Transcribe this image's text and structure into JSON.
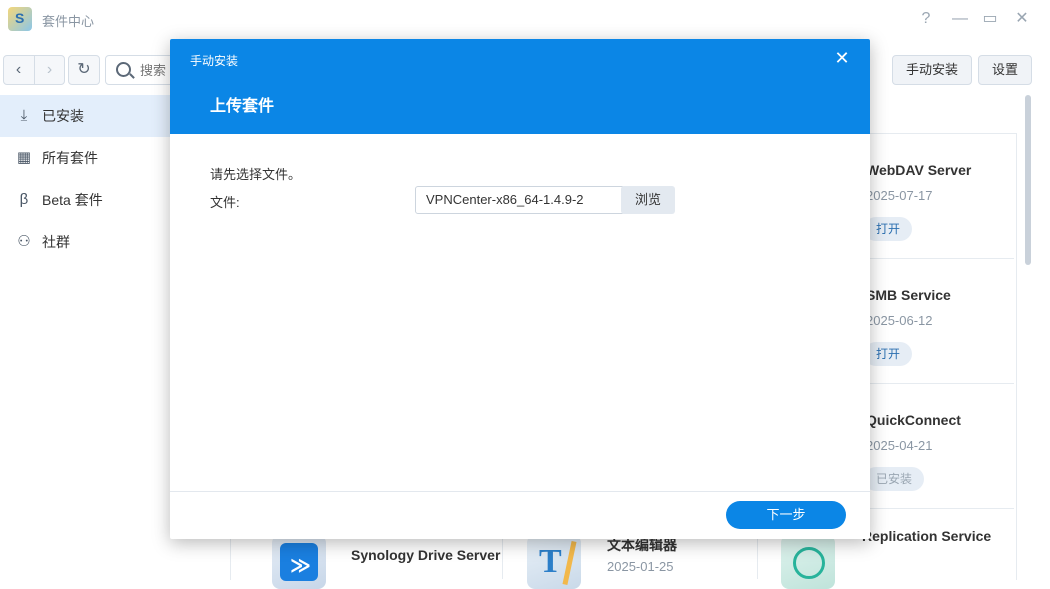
{
  "app": {
    "title": "套件中心"
  },
  "window_controls": {
    "help": "?",
    "minimize": "—",
    "maximize": "▭",
    "close": "✕"
  },
  "toolbar": {
    "back": "‹",
    "forward": "›",
    "refresh": "↻",
    "search_placeholder": "搜索",
    "manual_install_label": "手动安装",
    "settings_label": "设置"
  },
  "sidebar": {
    "items": [
      {
        "label": "已安装",
        "icon": "download-icon",
        "glyph": "⤓",
        "active": true
      },
      {
        "label": "所有套件",
        "icon": "grid-icon",
        "glyph": "▦",
        "active": false
      },
      {
        "label": "Beta 套件",
        "icon": "beta-icon",
        "glyph": "β",
        "active": false
      },
      {
        "label": "社群",
        "icon": "community-icon",
        "glyph": "⚇",
        "active": false
      }
    ]
  },
  "packages_right": [
    {
      "name": "WebDAV Server",
      "date": "2025-07-17",
      "action": "打开"
    },
    {
      "name": "SMB Service",
      "date": "2025-06-12",
      "action": "打开"
    },
    {
      "name": "QuickConnect",
      "date": "2025-04-21",
      "action": "已安装"
    },
    {
      "name": "Replication Service",
      "date": "",
      "action": ""
    }
  ],
  "packages_bottom": [
    {
      "name": "Synology Drive Server",
      "date": ""
    },
    {
      "name": "文本编辑器",
      "date": "2025-01-25"
    },
    {
      "name": "Replication Service",
      "date": ""
    }
  ],
  "modal": {
    "title": "手动安装",
    "close": "✕",
    "heading": "上传套件",
    "instruction": "请先选择文件。",
    "file_label": "文件:",
    "file_value": "VPNCenter-x86_64-1.4.9-2",
    "browse_label": "浏览",
    "next_label": "下一步"
  },
  "colors": {
    "accent": "#0b86e6",
    "sidebar_active": "#e3eefb"
  }
}
